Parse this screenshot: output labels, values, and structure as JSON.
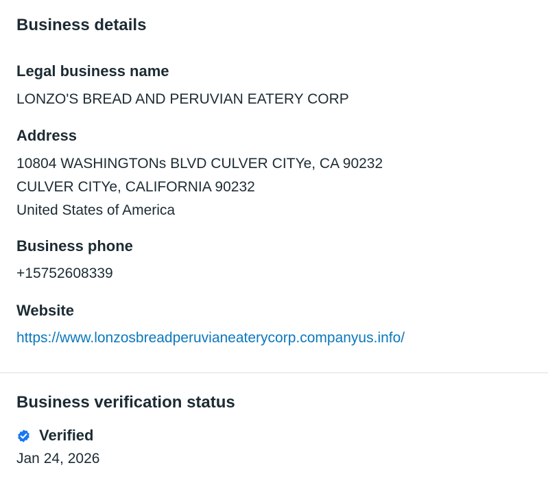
{
  "business_details": {
    "title": "Business details",
    "legal_name": {
      "label": "Legal business name",
      "value": "LONZO'S BREAD AND PERUVIAN EATERY CORP"
    },
    "address": {
      "label": "Address",
      "lines": [
        "10804 WASHINGTONs BLVD CULVER CITYe, CA 90232",
        "CULVER CITYe, CALIFORNIA 90232",
        "United States of America"
      ]
    },
    "phone": {
      "label": "Business phone",
      "value": "+15752608339"
    },
    "website": {
      "label": "Website",
      "value": "https://www.lonzosbreadperuvianeaterycorp.companyus.info/"
    }
  },
  "verification": {
    "title": "Business verification status",
    "status": "Verified",
    "date": "Jan 24, 2026",
    "icon": "verified-badge-icon",
    "accent": "#1877f2"
  },
  "colors": {
    "text": "#1c2b33",
    "link": "#0a78be",
    "divider": "#dadde1"
  }
}
